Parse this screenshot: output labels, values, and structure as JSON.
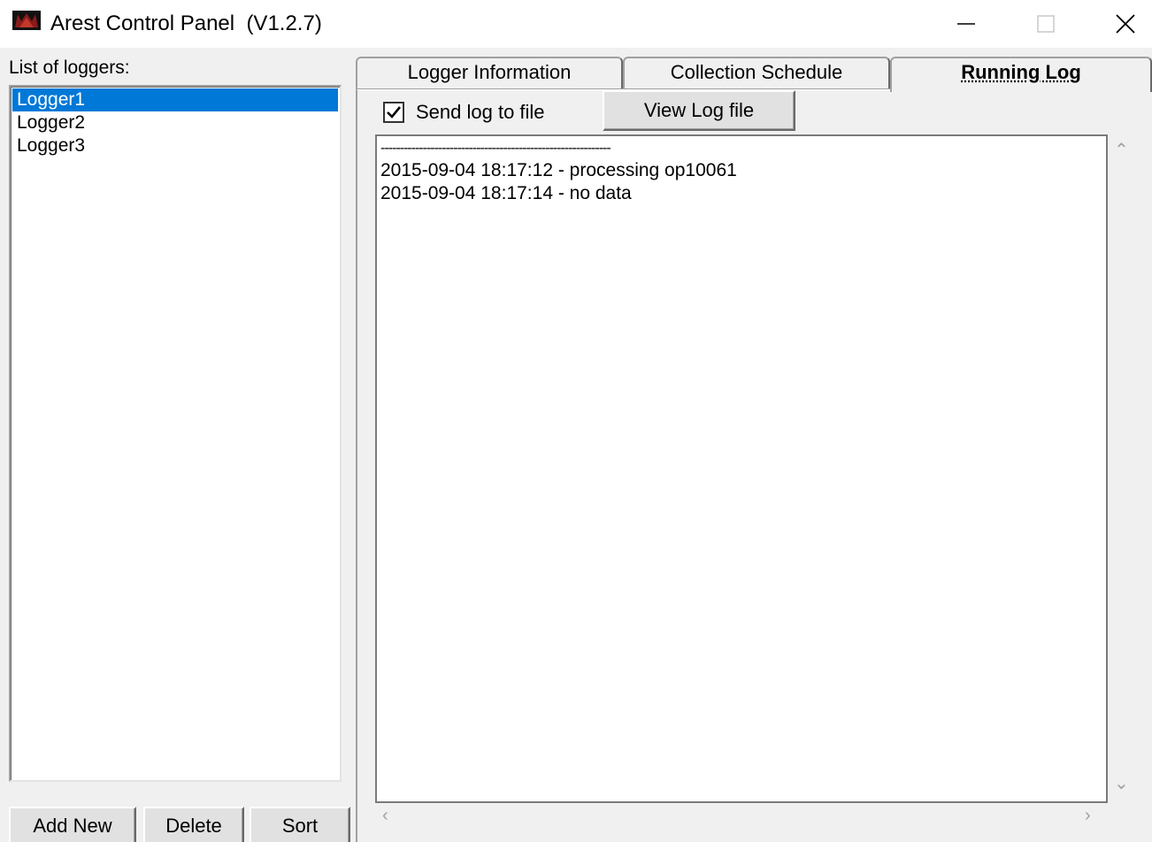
{
  "window": {
    "title": "Arest Control Panel  (V1.2.7)",
    "icon": "arest-app-icon",
    "controls": {
      "minimize": "minimize-icon",
      "maximize": "maximize-icon",
      "close": "close-icon"
    }
  },
  "loggers": {
    "label": "List of loggers:",
    "items": [
      {
        "label": "Logger1",
        "selected": true
      },
      {
        "label": "Logger2",
        "selected": false
      },
      {
        "label": "Logger3",
        "selected": false
      }
    ],
    "buttons": {
      "add": "Add New",
      "delete": "Delete",
      "sort": "Sort"
    }
  },
  "tabs": [
    {
      "label": "Logger Information",
      "active": false
    },
    {
      "label": "Collection Schedule",
      "active": false
    },
    {
      "label": "Running Log",
      "active": true
    }
  ],
  "running_log": {
    "send_to_file_label": "Send log to file",
    "send_to_file_checked": true,
    "view_button": "View Log file",
    "lines": [
      "------------------------------------------------------------",
      "2015-09-04 18:17:12 - processing op10061",
      "2015-09-04 18:17:14 - no data"
    ]
  },
  "colors": {
    "selection": "#0078d7",
    "window_bg": "#f0f0f0"
  }
}
